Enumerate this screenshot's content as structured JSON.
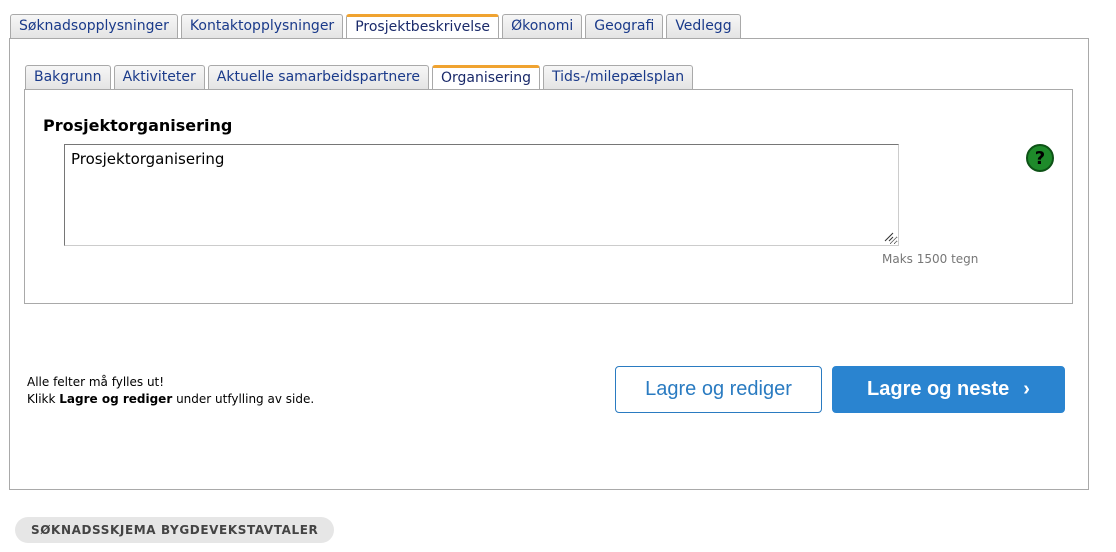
{
  "outer_tabs": [
    {
      "label": "Søknadsopplysninger"
    },
    {
      "label": "Kontaktopplysninger"
    },
    {
      "label": "Prosjektbeskrivelse",
      "active": true
    },
    {
      "label": "Økonomi"
    },
    {
      "label": "Geografi"
    },
    {
      "label": "Vedlegg"
    }
  ],
  "inner_tabs": [
    {
      "label": "Bakgrunn"
    },
    {
      "label": "Aktiviteter"
    },
    {
      "label": "Aktuelle samarbeidspartnere"
    },
    {
      "label": "Organisering",
      "active": true
    },
    {
      "label": "Tids-/milepælsplan"
    }
  ],
  "section": {
    "title": "Prosjektorganisering",
    "textarea_value": "Prosjektorganisering",
    "max_note": "Maks 1500 tegn",
    "help_icon": "question-icon"
  },
  "footnote": {
    "line1": "Alle felter må fylles ut!",
    "line2_prefix": "Klikk ",
    "line2_bold": "Lagre og rediger",
    "line2_suffix": " under utfylling av side."
  },
  "buttons": {
    "save_edit": "Lagre og rediger",
    "save_next": "Lagre og neste",
    "next_icon": "chevron-right-icon"
  },
  "badge": "SØKNADSSKJEMA BYGDEVEKSTAVTALER",
  "colors": {
    "active_tab_accent": "#f0a330",
    "primary_button": "#2a84d0",
    "help_icon": "#1e8a2a"
  }
}
